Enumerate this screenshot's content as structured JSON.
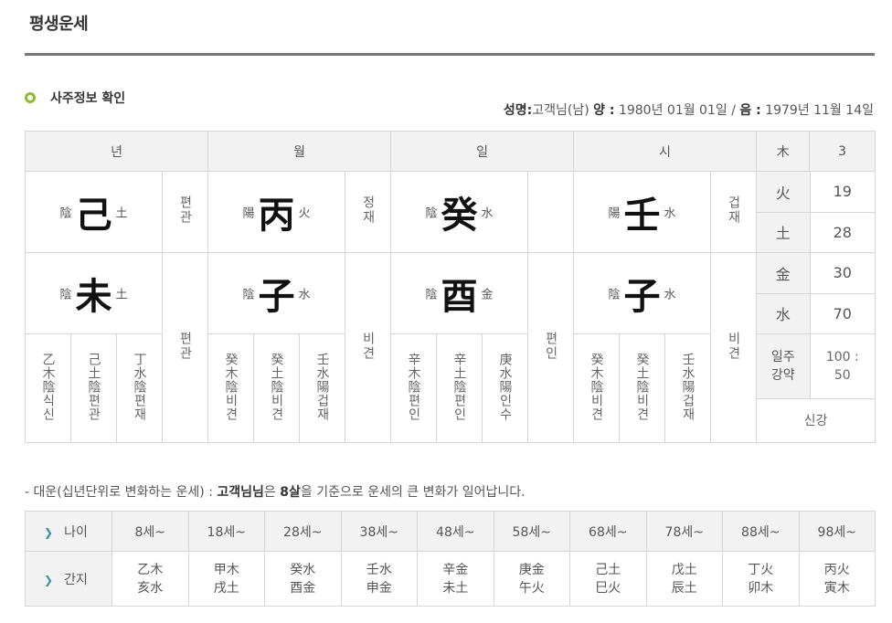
{
  "page": {
    "title": "평생운세"
  },
  "section": {
    "title": "사주정보 확인"
  },
  "birth": {
    "name_label": "성명:",
    "name_value": "고객님(남)",
    "solar_label": "양 :",
    "solar_value": "1980년 01월 01일 /",
    "lunar_label": "음 :",
    "lunar_value": "1979년 11월 14일"
  },
  "pillars": {
    "headers": [
      "년",
      "월",
      "일",
      "시"
    ],
    "year": {
      "stem_yy": "陰",
      "stem": "己",
      "stem_el": "土",
      "stem_god": "편관",
      "branch_yy": "陰",
      "branch": "未",
      "branch_el": "土",
      "branch_god": "편관",
      "hidden": [
        "乙木陰식신",
        "己土陰편관",
        "丁水陰편재"
      ]
    },
    "month": {
      "stem_yy": "陽",
      "stem": "丙",
      "stem_el": "火",
      "stem_god": "정재",
      "branch_yy": "陰",
      "branch": "子",
      "branch_el": "水",
      "branch_god": "비견",
      "hidden": [
        "癸木陰비견",
        "癸土陰비견",
        "壬水陽겁재"
      ]
    },
    "day": {
      "stem_yy": "陰",
      "stem": "癸",
      "stem_el": "水",
      "stem_god": "",
      "branch_yy": "陰",
      "branch": "酉",
      "branch_el": "金",
      "branch_god": "편인",
      "hidden": [
        "辛木陰편인",
        "辛土陰편인",
        "庚水陽인수"
      ]
    },
    "hour": {
      "stem_yy": "陽",
      "stem": "壬",
      "stem_el": "水",
      "stem_god": "겁재",
      "branch_yy": "陰",
      "branch": "子",
      "branch_el": "水",
      "branch_god": "비견",
      "hidden": [
        "癸木陰비견",
        "癸土陰비견",
        "壬水陽겁재"
      ]
    }
  },
  "elements": [
    {
      "name": "木",
      "value": "3"
    },
    {
      "name": "火",
      "value": "19"
    },
    {
      "name": "土",
      "value": "28"
    },
    {
      "name": "金",
      "value": "30"
    },
    {
      "name": "水",
      "value": "70"
    }
  ],
  "strength": {
    "label_1": "일주",
    "label_2": "강약",
    "value_1": "100 :",
    "value_2": "50",
    "result": "신강"
  },
  "daeun_note": {
    "prefix": "- 대운(십년단위로 변화하는 운세) :",
    "name": "고객님님",
    "mid": "은",
    "age": "8살",
    "suffix": "을 기준으로 운세의 큰 변화가 일어납니다."
  },
  "daeun": {
    "age_label": "나이",
    "ganji_label": "간지",
    "ages": [
      "8세~",
      "18세~",
      "28세~",
      "38세~",
      "48세~",
      "58세~",
      "68세~",
      "78세~",
      "88세~",
      "98세~"
    ],
    "stems": [
      "乙木",
      "甲木",
      "癸水",
      "壬水",
      "辛金",
      "庚金",
      "己土",
      "戊土",
      "丁火",
      "丙火"
    ],
    "branches": [
      "亥水",
      "戌土",
      "酉金",
      "申金",
      "未土",
      "午火",
      "巳火",
      "辰土",
      "卯木",
      "寅木"
    ],
    "highlight_index": 3,
    "highlight_color": "#c0392b"
  },
  "colors": {
    "accent": "#8bbf2a",
    "header_bg": "#f2f2f2",
    "border": "#d6d6d6",
    "highlight": "#c0392b"
  }
}
